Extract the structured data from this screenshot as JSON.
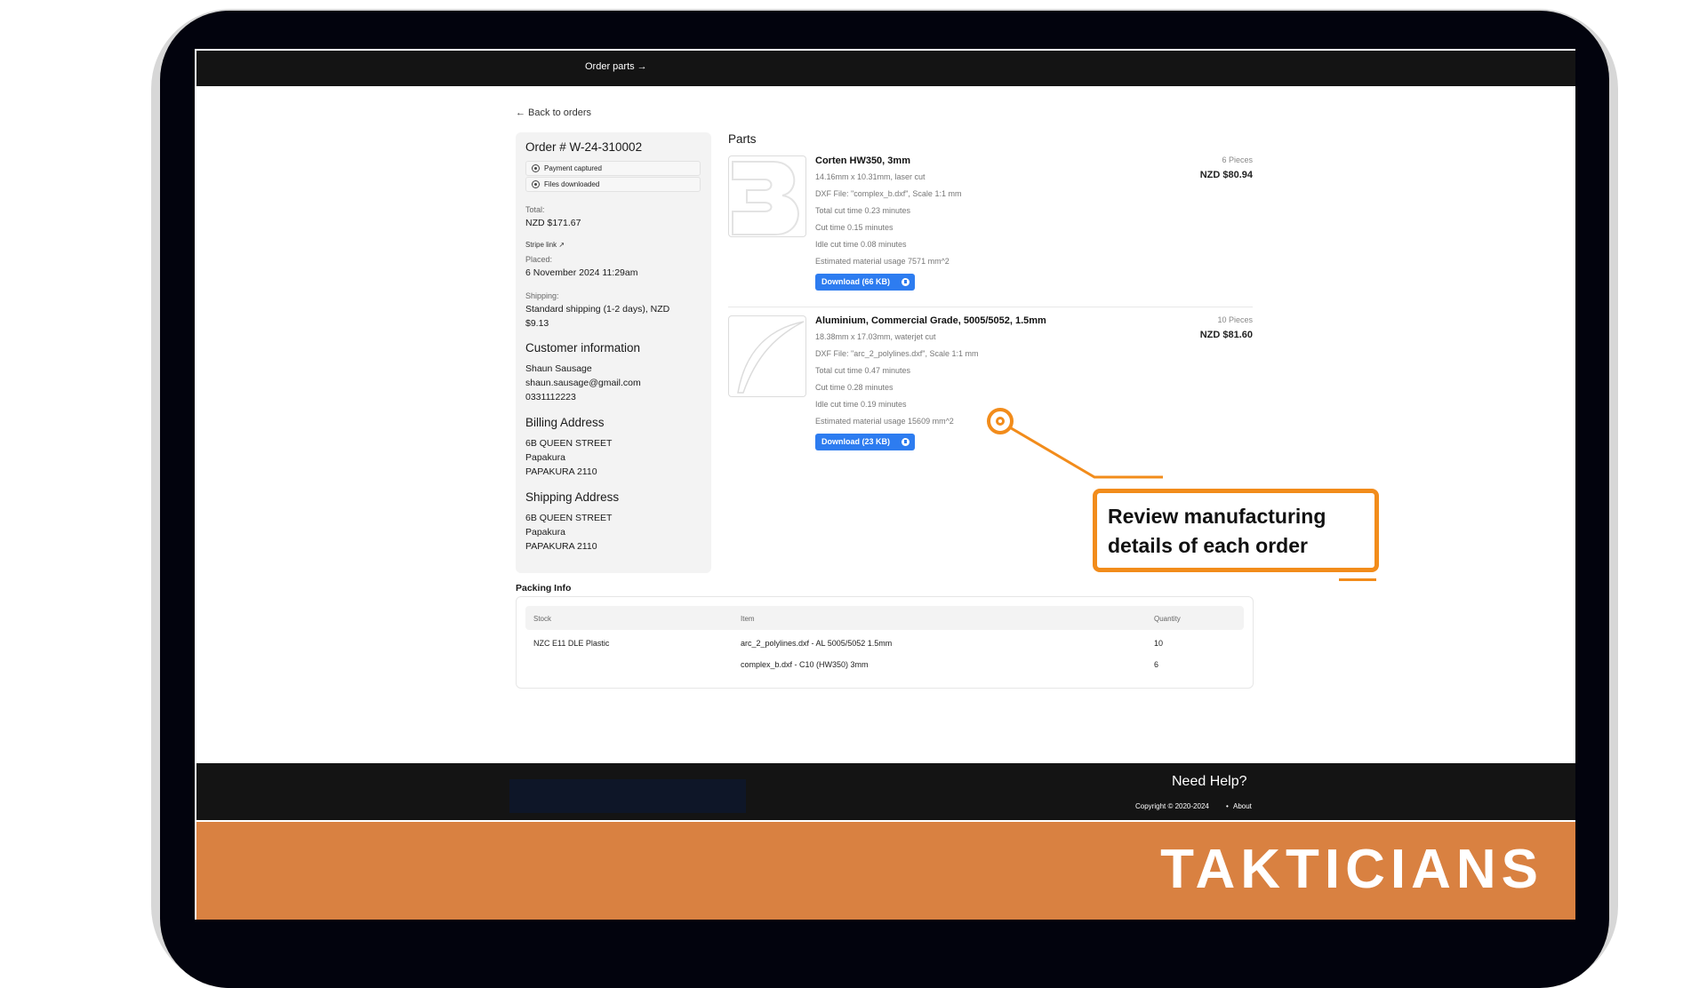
{
  "nav": {
    "order_parts": "Order parts →"
  },
  "back_link": "← Back to orders",
  "order": {
    "number": "Order # W-24-310002",
    "statuses": [
      "Payment captured",
      "Files downloaded"
    ],
    "total_label": "Total:",
    "total_value": "NZD $171.67",
    "stripe_link": "Stripe link ↗",
    "placed_label": "Placed:",
    "placed_value": "6 November 2024 11:29am",
    "shipping_label": "Shipping:",
    "shipping_value_1": "Standard shipping (1-2 days), NZD",
    "shipping_value_2": "$9.13"
  },
  "customer": {
    "heading": "Customer information",
    "name": "Shaun Sausage",
    "email": "shaun.sausage@gmail.com",
    "phone": "0331112223"
  },
  "billing": {
    "heading": "Billing Address",
    "line1": "6B QUEEN STREET",
    "line2": "Papakura",
    "line3": "PAPAKURA 2110"
  },
  "shipping_address": {
    "heading": "Shipping Address",
    "line1": "6B QUEEN STREET",
    "line2": "Papakura",
    "line3": "PAPAKURA 2110"
  },
  "parts": {
    "title": "Parts",
    "items": [
      {
        "name": "Corten HW350, 3mm",
        "size": "14.16mm x 10.31mm, laser cut",
        "dxf": "DXF File: \"complex_b.dxf\", Scale 1:1 mm",
        "total_cut": "Total cut time 0.23 minutes",
        "cut": "Cut time 0.15 minutes",
        "idle": "Idle cut time 0.08 minutes",
        "material": "Estimated material usage 7571 mm^2",
        "download": "Download (66 KB)",
        "pieces": "6 Pieces",
        "price": "NZD $80.94"
      },
      {
        "name": "Aluminium, Commercial Grade, 5005/5052, 1.5mm",
        "size": "18.38mm x 17.03mm, waterjet cut",
        "dxf": "DXF File: \"arc_2_polylines.dxf\", Scale 1:1 mm",
        "total_cut": "Total cut time 0.47 minutes",
        "cut": "Cut time 0.28 minutes",
        "idle": "Idle cut time 0.19 minutes",
        "material": "Estimated material usage 15609 mm^2",
        "download": "Download (23 KB)",
        "pieces": "10 Pieces",
        "price": "NZD $81.60"
      }
    ]
  },
  "packing": {
    "title": "Packing Info",
    "headers": [
      "Stock",
      "Item",
      "Quantity"
    ],
    "rows": [
      [
        "NZC E11 DLE Plastic",
        "arc_2_polylines.dxf - AL 5005/5052 1.5mm",
        "10"
      ],
      [
        "",
        "complex_b.dxf - C10 (HW350) 3mm",
        "6"
      ]
    ]
  },
  "footer": {
    "need_help": "Need Help?",
    "copyright": "Copyright © 2020-2024",
    "dot": "•",
    "about": "About"
  },
  "brand": "TAKTICIANS",
  "callout": {
    "text": "Review manufacturing details of each order"
  },
  "colors": {
    "accent": "#f28c1b",
    "brand_band": "#d98141",
    "button": "#2d7cf0",
    "bar": "#141414"
  }
}
